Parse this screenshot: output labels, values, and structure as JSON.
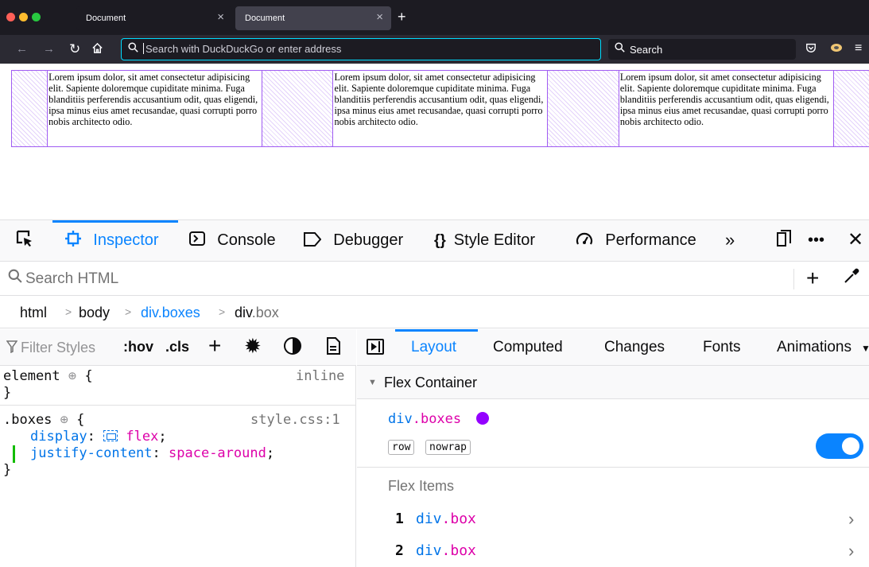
{
  "browser": {
    "tabs": [
      {
        "title": "Document",
        "close": "×"
      },
      {
        "title": "Document",
        "close": "×"
      }
    ],
    "new_tab": "+",
    "url_placeholder": "Search with DuckDuckGo or enter address",
    "search_placeholder": "Search"
  },
  "page": {
    "box_text": "Lorem ipsum dolor, sit amet consectetur adipisicing elit. Sapiente doloremque cupiditate minima. Fuga blanditiis perferendis accusantium odit, quas eligendi, ipsa minus eius amet recusandae, quasi corrupti porro nobis architecto odio.",
    "boxes": [
      "Lorem ipsum dolor, sit amet consectetur adipisicing elit. Sapiente doloremque cupiditate minima. Fuga blanditiis perferendis accusantium odit, quas eligendi, ipsa minus eius amet recusandae, quasi corrupti porro nobis architecto odio.",
      "Lorem ipsum dolor, sit amet consectetur adipisicing elit. Sapiente doloremque cupiditate minima. Fuga blanditiis perferendis accusantium odit, quas eligendi, ipsa minus eius amet recusandae, quasi corrupti porro nobis architecto odio.",
      "Lorem ipsum dolor, sit amet consectetur adipisicing elit. Sapiente doloremque cupiditate minima. Fuga blanditiis perferendis accusantium odit, quas eligendi, ipsa minus eius amet recusandae, quasi corrupti porro nobis architecto odio."
    ]
  },
  "devtools": {
    "tabs": {
      "inspector": "Inspector",
      "console": "Console",
      "debugger": "Debugger",
      "style_editor": "Style Editor",
      "performance": "Performance"
    },
    "search_placeholder": "Search HTML",
    "breadcrumbs": {
      "html": "html",
      "body": "body",
      "boxes_tag": "div",
      "boxes_cls": ".boxes",
      "box_tag": "div",
      "box_cls": ".box"
    },
    "rules": {
      "filter_placeholder": "Filter Styles",
      "hov": ":hov",
      "cls": ".cls",
      "element_selector": "element",
      "element_source": "inline",
      "boxes_selector": ".boxes",
      "boxes_source": "style.css:1",
      "decl1_prop": "display",
      "decl1_val": "flex",
      "decl2_prop": "justify-content",
      "decl2_val": "space-around",
      "open_brace": "{",
      "close_brace": "}"
    },
    "layout": {
      "tabs": {
        "layout": "Layout",
        "computed": "Computed",
        "changes": "Changes",
        "fonts": "Fonts",
        "animations": "Animations"
      },
      "section_title": "Flex Container",
      "container_tag": "div",
      "container_cls": ".boxes",
      "badge_direction": "row",
      "badge_wrap": "nowrap",
      "flex_items_title": "Flex Items",
      "items": [
        {
          "num": "1",
          "tag": "div",
          "cls": ".box"
        },
        {
          "num": "2",
          "tag": "div",
          "cls": ".box"
        }
      ]
    }
  },
  "colors": {
    "accent": "#0a84ff",
    "flex_highlight": "#9400ff",
    "chrome_dark": "#1c1b22"
  }
}
